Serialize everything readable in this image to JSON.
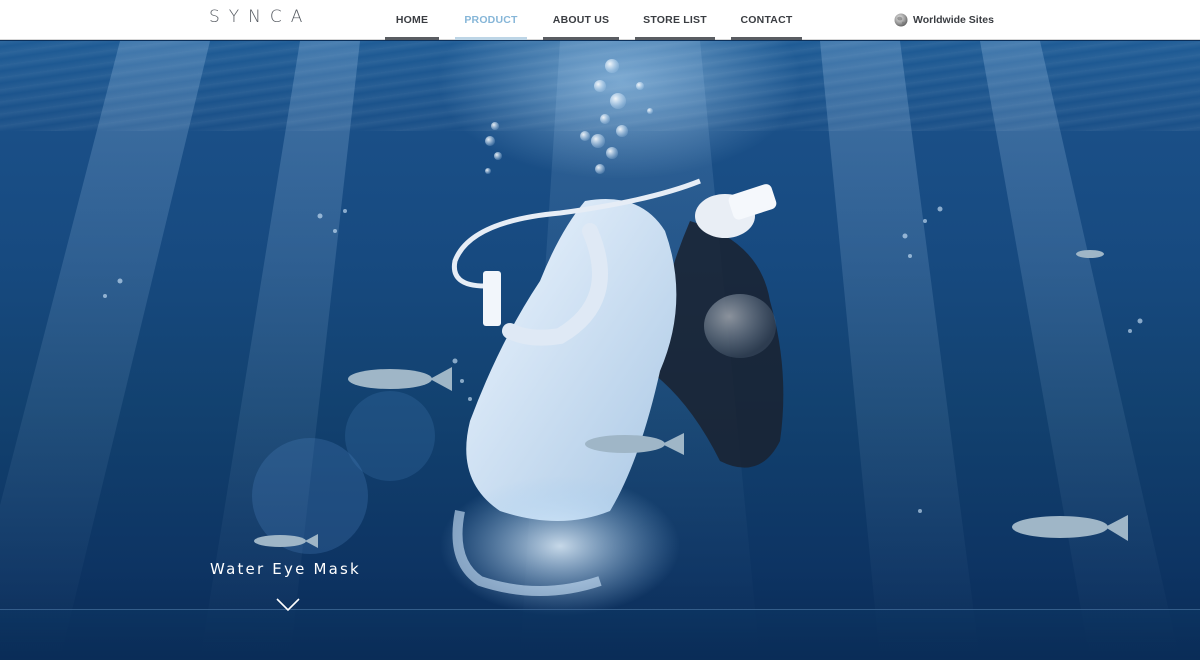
{
  "header": {
    "logo_text": "SYNCA",
    "nav": [
      {
        "label": "HOME",
        "active": false
      },
      {
        "label": "PRODUCT",
        "active": true
      },
      {
        "label": "ABOUT US",
        "active": false
      },
      {
        "label": "STORE LIST",
        "active": false
      },
      {
        "label": "CONTACT",
        "active": false
      }
    ],
    "worldwide_label": "Worldwide Sites",
    "globe_icon": "globe-icon"
  },
  "hero": {
    "title": "Water Eye Mask",
    "scroll_icon": "chevron-down-icon"
  },
  "colors": {
    "accent": "#86b6d8",
    "nav_text": "#3a3d42",
    "water_top": "#1f5c96",
    "water_bottom": "#0a2a55"
  }
}
